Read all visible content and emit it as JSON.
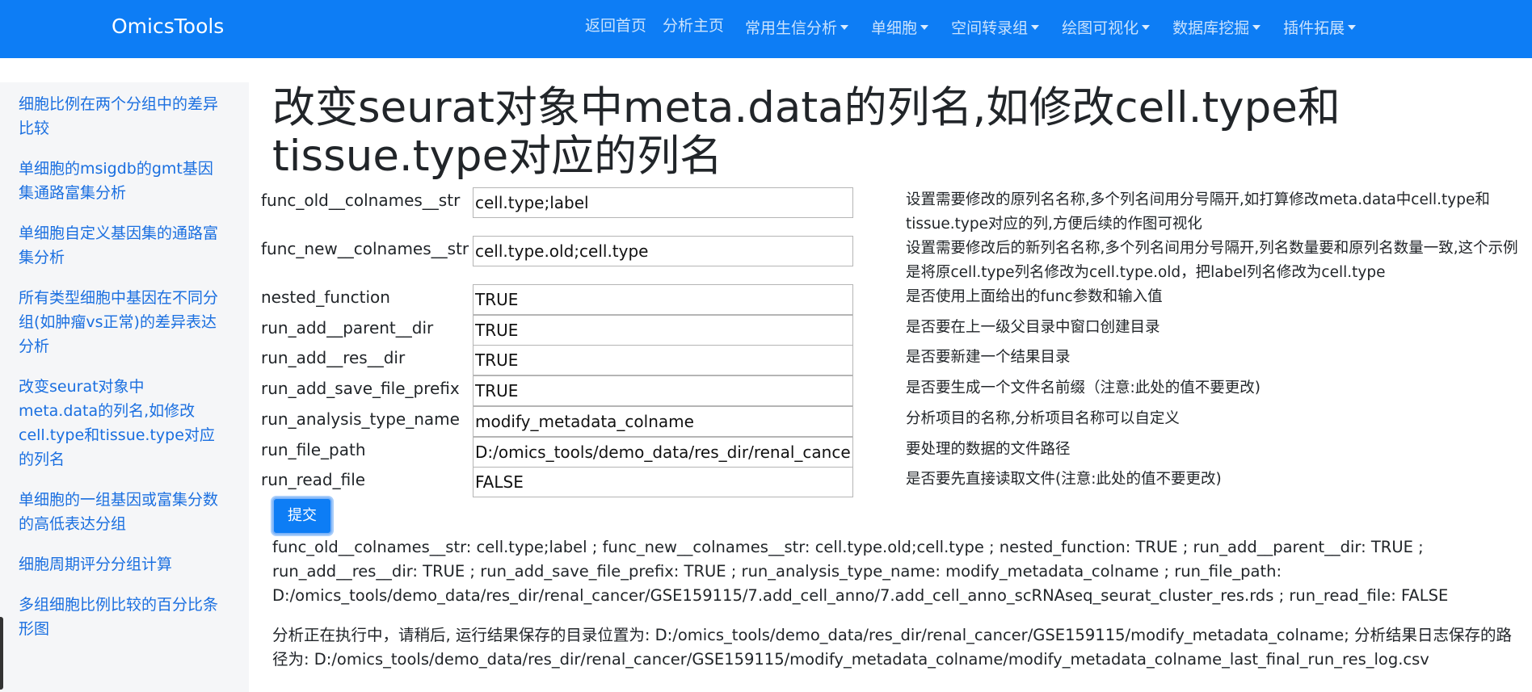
{
  "navbar": {
    "brand": "OmicsTools",
    "links": [
      "返回首页",
      "分析主页"
    ],
    "dropdowns": [
      "常用生信分析",
      "单细胞",
      "空间转录组",
      "绘图可视化",
      "数据库挖掘",
      "插件拓展"
    ]
  },
  "sidebar": {
    "items": [
      "细胞比例在两个分组中的差异比较",
      "单细胞的msigdb的gmt基因集通路富集分析",
      "单细胞自定义基因集的通路富集分析",
      "所有类型细胞中基因在不同分组(如肿瘤vs正常)的差异表达分析",
      "改变seurat对象中meta.data的列名,如修改cell.type和tissue.type对应的列名",
      "单细胞的一组基因或富集分数的高低表达分组",
      "细胞周期评分分组计算",
      "多组细胞比例比较的百分比条形图"
    ]
  },
  "main": {
    "title": "改变seurat对象中meta.data的列名,如修改cell.type和tissue.type对应的列名",
    "form": [
      {
        "label": "func_old__colnames__str",
        "value": "cell.type;label",
        "desc": "设置需要修改的原列名名称,多个列名间用分号隔开,如打算修改meta.data中cell.type和tissue.type对应的列,方便后续的作图可视化"
      },
      {
        "label": "func_new__colnames__str",
        "value": "cell.type.old;cell.type",
        "desc": "设置需要修改后的新列名名称,多个列名间用分号隔开,列名数量要和原列名数量一致,这个示例是将原cell.type列名修改为cell.type.old，把label列名修改为cell.type"
      },
      {
        "label": "nested_function",
        "value": "TRUE",
        "desc": "是否使用上面给出的func参数和输入值"
      },
      {
        "label": "run_add__parent__dir",
        "value": "TRUE",
        "desc": "是否要在上一级父目录中窗口创建目录"
      },
      {
        "label": "run_add__res__dir",
        "value": "TRUE",
        "desc": "是否要新建一个结果目录"
      },
      {
        "label": "run_add_save_file_prefix",
        "value": "TRUE",
        "desc": "是否要生成一个文件名前缀（注意:此处的值不要更改)"
      },
      {
        "label": "run_analysis_type_name",
        "value": "modify_metadata_colname",
        "desc": "分析项目的名称,分析项目名称可以自定义"
      },
      {
        "label": "run_file_path",
        "value": "D:/omics_tools/demo_data/res_dir/renal_cancer/GSE159115/7.add_cell_anno/7.add_cell_anno_scRNAseq_seurat_cluster_res.rds",
        "desc": "要处理的数据的文件路径"
      },
      {
        "label": "run_read_file",
        "value": "FALSE",
        "desc": "是否要先直接读取文件(注意:此处的值不要更改)"
      }
    ],
    "submit_label": "提交",
    "result_params": "func_old__colnames__str: cell.type;label ; func_new__colnames__str: cell.type.old;cell.type ; nested_function: TRUE ; run_add__parent__dir: TRUE ; run_add__res__dir: TRUE ; run_add_save_file_prefix: TRUE ; run_analysis_type_name: modify_metadata_colname ; run_file_path: D:/omics_tools/demo_data/res_dir/renal_cancer/GSE159115/7.add_cell_anno/7.add_cell_anno_scRNAseq_seurat_cluster_res.rds ; run_read_file: FALSE",
    "result_status": "分析正在执行中，请稍后, 运行结果保存的目录位置为: D:/omics_tools/demo_data/res_dir/renal_cancer/GSE159115/modify_metadata_colname; 分析结果日志保存的路径为: D:/omics_tools/demo_data/res_dir/renal_cancer/GSE159115/modify_metadata_colname/modify_metadata_colname_last_final_run_res_log.csv"
  }
}
